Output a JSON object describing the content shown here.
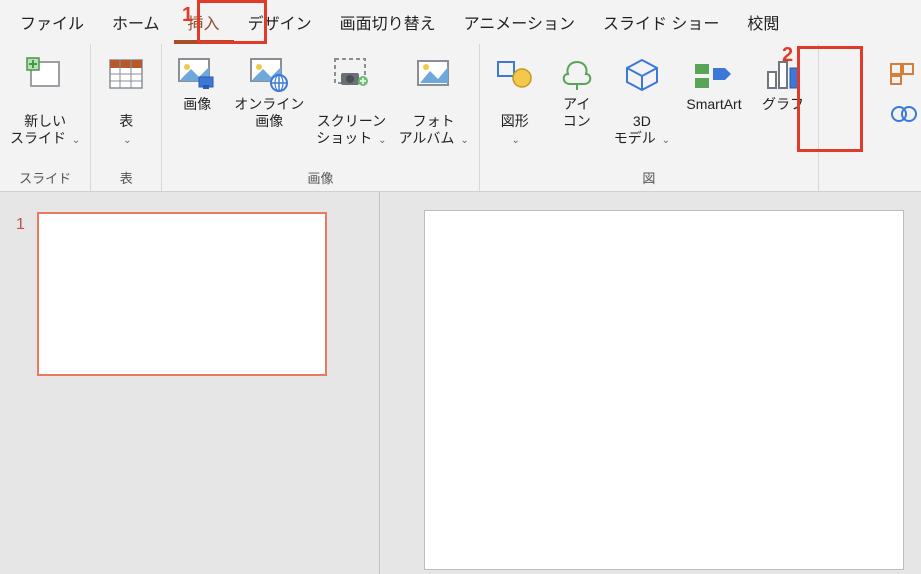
{
  "tabs": {
    "file": "ファイル",
    "home": "ホーム",
    "insert": "挿入",
    "design": "デザイン",
    "transitions": "画面切り替え",
    "animations": "アニメーション",
    "slideshow": "スライド ショー",
    "review": "校閲"
  },
  "ribbon": {
    "groups": {
      "slides": {
        "label": "スライド",
        "new_slide": "新しい\nスライド"
      },
      "tables": {
        "label": "表",
        "table": "表"
      },
      "images": {
        "label": "画像",
        "pictures": "画像",
        "online_pictures": "オンライン\n画像",
        "screenshot": "スクリーン\nショット",
        "photo_album": "フォト\nアルバム"
      },
      "illustrations": {
        "label": "図",
        "shapes": "図形",
        "icons": "アイ\nコン",
        "models3d": "3D\nモデル",
        "smartart": "SmartArt",
        "chart": "グラフ"
      }
    },
    "caret": "⌄"
  },
  "annotations": {
    "n1": "1",
    "n2": "2"
  },
  "thumbs": {
    "n1": "1"
  }
}
